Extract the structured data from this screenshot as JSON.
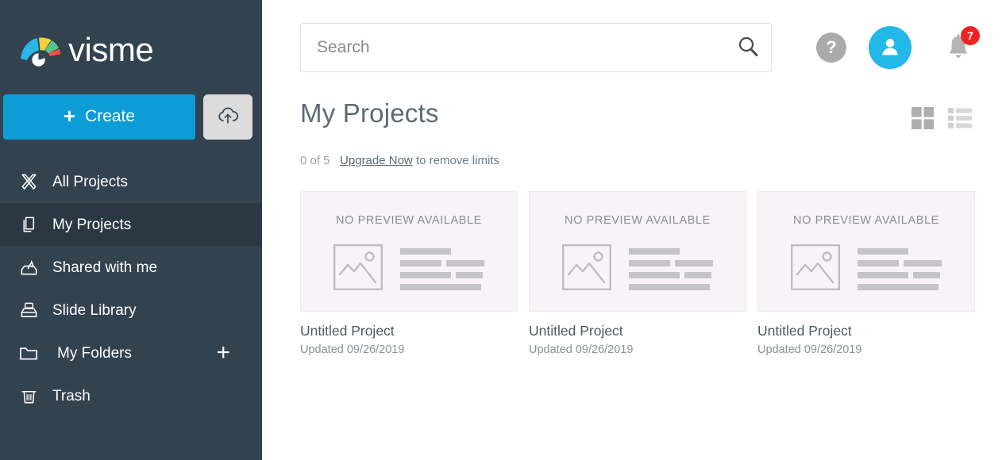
{
  "brand": {
    "name": "visme",
    "logo_icon": "visme-fan-logo",
    "accent_color": "#0d9dd6",
    "sidebar_color": "#33424f"
  },
  "sidebar": {
    "create_button": {
      "label": "Create",
      "icon": "plus-icon"
    },
    "upload_button": {
      "icon": "cloud-upload-icon"
    },
    "items": [
      {
        "label": "All Projects",
        "icon": "crossed-tools-icon",
        "active": false
      },
      {
        "label": "My Projects",
        "icon": "documents-stack-icon",
        "active": true
      },
      {
        "label": "Shared with me",
        "icon": "shared-inbox-icon",
        "active": false
      },
      {
        "label": "Slide Library",
        "icon": "slide-library-icon",
        "active": false
      },
      {
        "label": "My Folders",
        "icon": "folder-icon",
        "active": false,
        "action_icon": "plus-icon"
      },
      {
        "label": "Trash",
        "icon": "trash-icon",
        "active": false
      }
    ]
  },
  "header": {
    "search": {
      "placeholder": "Search",
      "value": "",
      "icon": "search-icon"
    },
    "help_button": {
      "label": "?",
      "icon": "question-mark-icon"
    },
    "avatar": {
      "icon": "user-avatar-icon"
    },
    "notifications": {
      "icon": "bell-icon",
      "badge_count": "7",
      "badge_color": "#ef2222"
    }
  },
  "page": {
    "title": "My Projects",
    "limits": {
      "count": "0 of 5",
      "upgrade_link": "Upgrade Now",
      "suffix": "to remove limits"
    },
    "view_toggle": {
      "grid": {
        "icon": "grid-view-icon",
        "active": true
      },
      "list": {
        "icon": "list-view-icon",
        "active": false
      }
    }
  },
  "projects": [
    {
      "preview_text": "NO PREVIEW AVAILABLE",
      "title": "Untitled Project",
      "date": "Updated 09/26/2019"
    },
    {
      "preview_text": "NO PREVIEW AVAILABLE",
      "title": "Untitled Project",
      "date": "Updated 09/26/2019"
    },
    {
      "preview_text": "NO PREVIEW AVAILABLE",
      "title": "Untitled Project",
      "date": "Updated 09/26/2019"
    }
  ]
}
